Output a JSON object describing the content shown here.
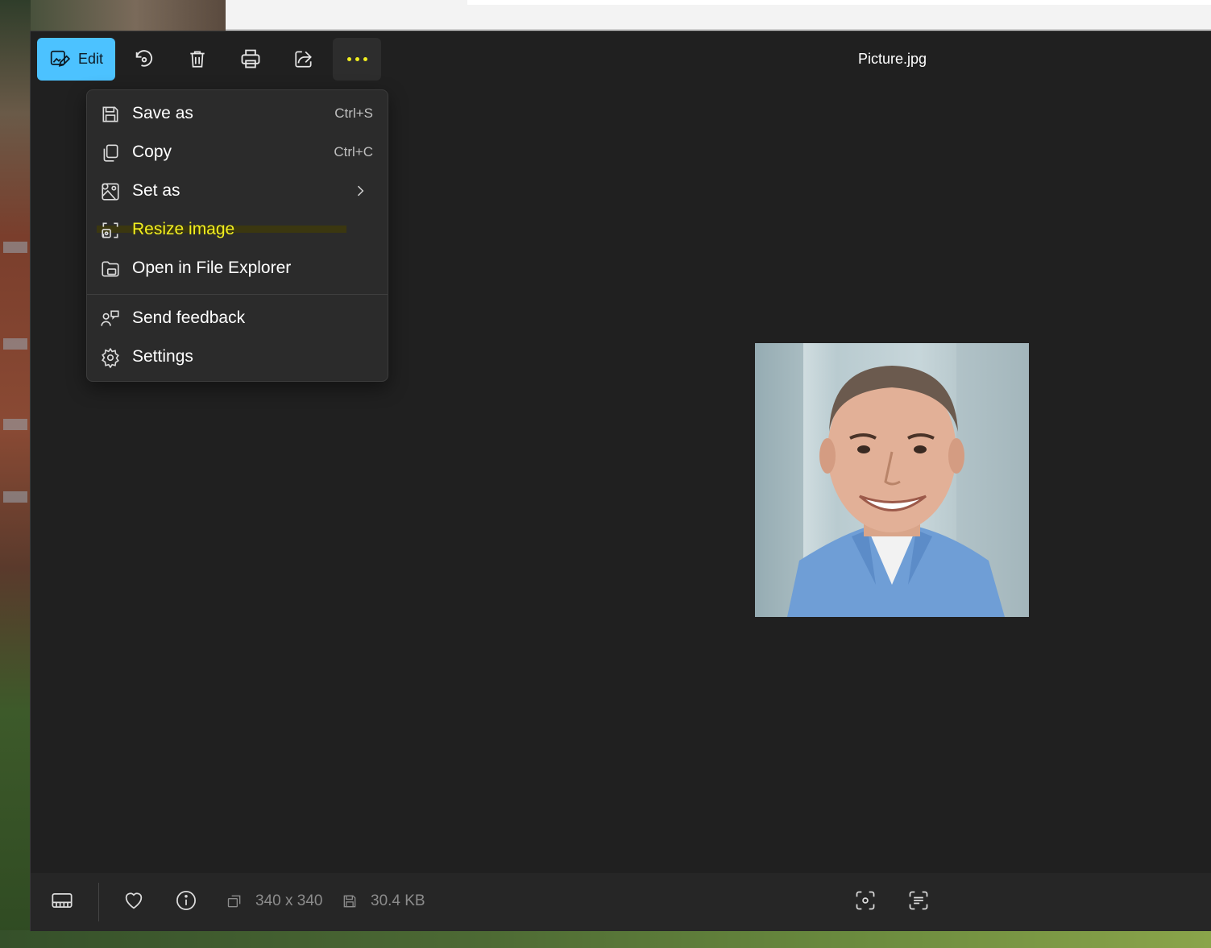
{
  "window": {
    "title": "Picture.jpg"
  },
  "toolbar": {
    "edit_label": "Edit",
    "buttons": [
      "rotate-icon",
      "delete-icon",
      "print-icon",
      "share-icon",
      "more-icon"
    ]
  },
  "menu": {
    "items": [
      {
        "label": "Save as",
        "shortcut": "Ctrl+S",
        "icon": "save-icon"
      },
      {
        "label": "Copy",
        "shortcut": "Ctrl+C",
        "icon": "copy-icon"
      },
      {
        "label": "Set as",
        "shortcut": "",
        "icon": "set-as-icon",
        "submenu": true
      },
      {
        "label": "Resize image",
        "shortcut": "",
        "icon": "resize-icon",
        "highlighted": true
      },
      {
        "label": "Open in File Explorer",
        "shortcut": "",
        "icon": "folder-icon"
      },
      {
        "label": "Send feedback",
        "shortcut": "",
        "icon": "feedback-icon"
      },
      {
        "label": "Settings",
        "shortcut": "",
        "icon": "gear-icon"
      }
    ]
  },
  "statusbar": {
    "dimensions": "340 x 340",
    "file_size": "30.4 KB"
  },
  "colors": {
    "accent": "#4cc2ff",
    "highlight": "#f2ef1f",
    "background": "#202020",
    "menu_bg": "#2b2b2b"
  }
}
